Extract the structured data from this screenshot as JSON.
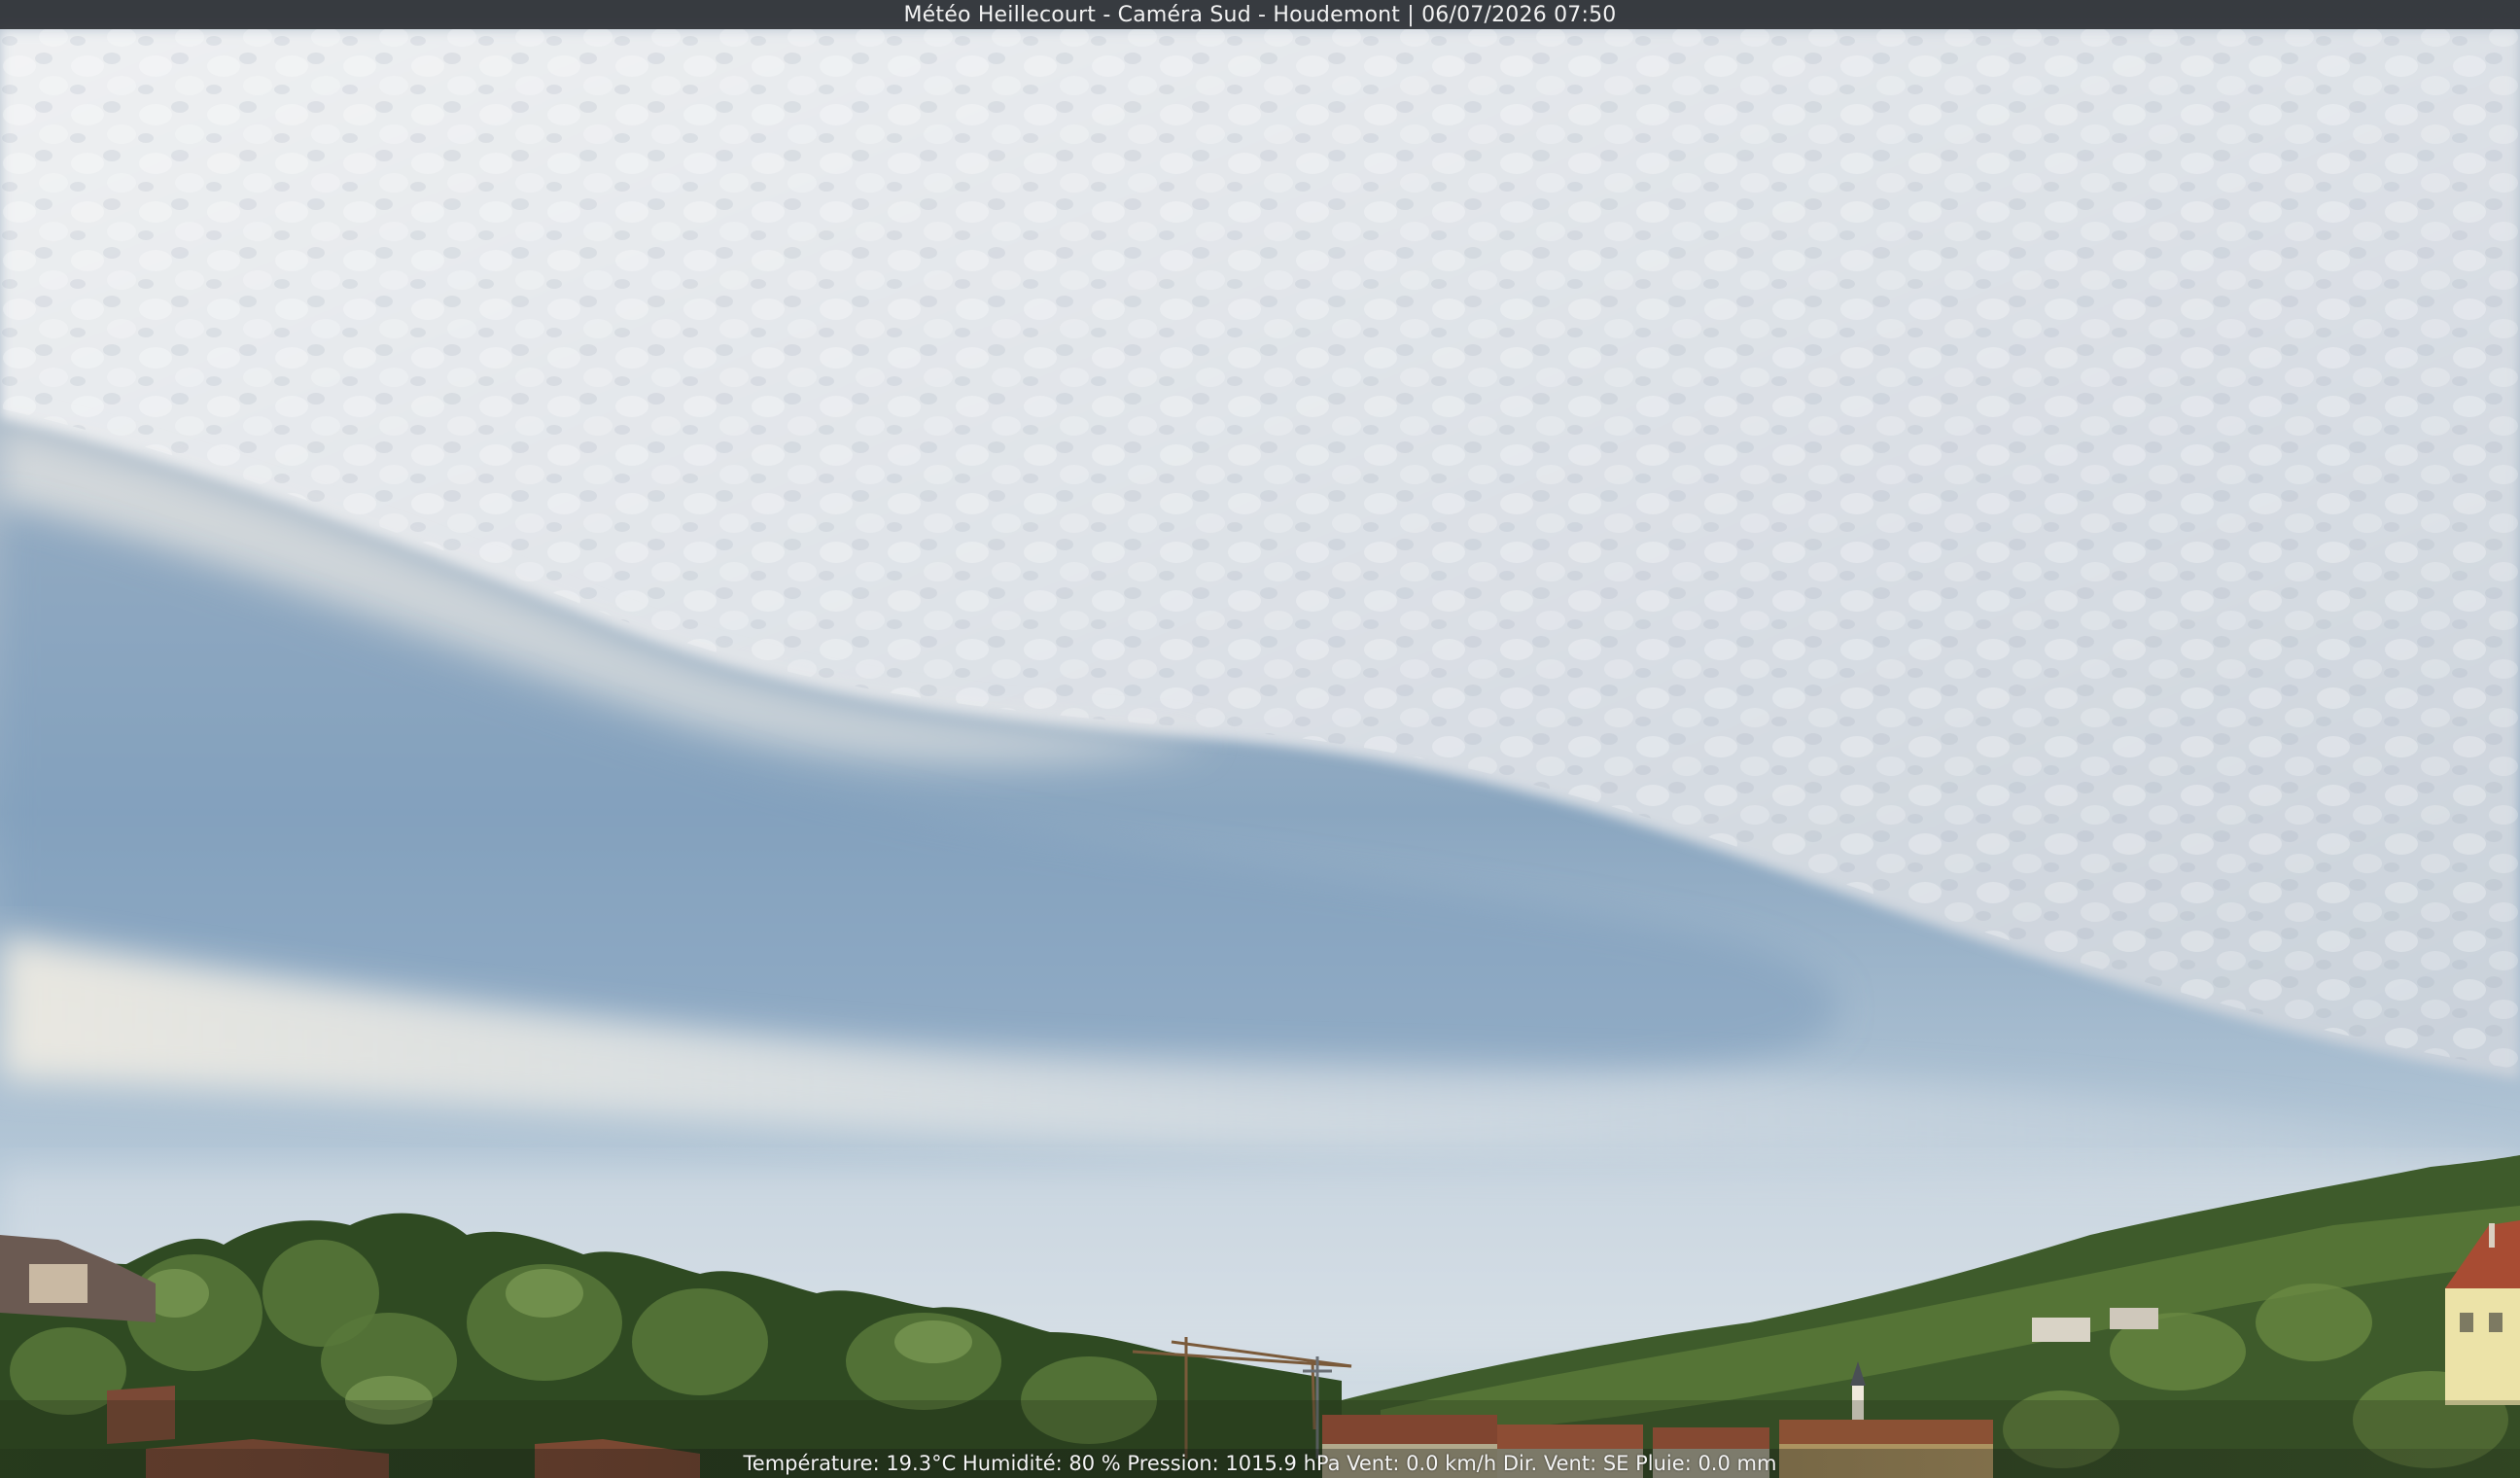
{
  "overlay": {
    "title": "Météo Heillecourt - Caméra Sud - Houdemont | 06/07/2026 07:50",
    "weather_line": "Température: 19.3°C  Humidité: 80 % Pression: 1015.9 hPa Vent: 0.0 km/h Dir. Vent: SE Pluie: 0.0 mm"
  },
  "scene": {
    "description_colors": {
      "sky_blue": "#7f9fbd",
      "sky_pale": "#c9d6e0",
      "cloud": "#e4e6ea",
      "tree_dark": "#2f4a22",
      "tree_light": "#6e8f46",
      "roof": "#a2513a",
      "wall": "#e7dba4"
    }
  }
}
